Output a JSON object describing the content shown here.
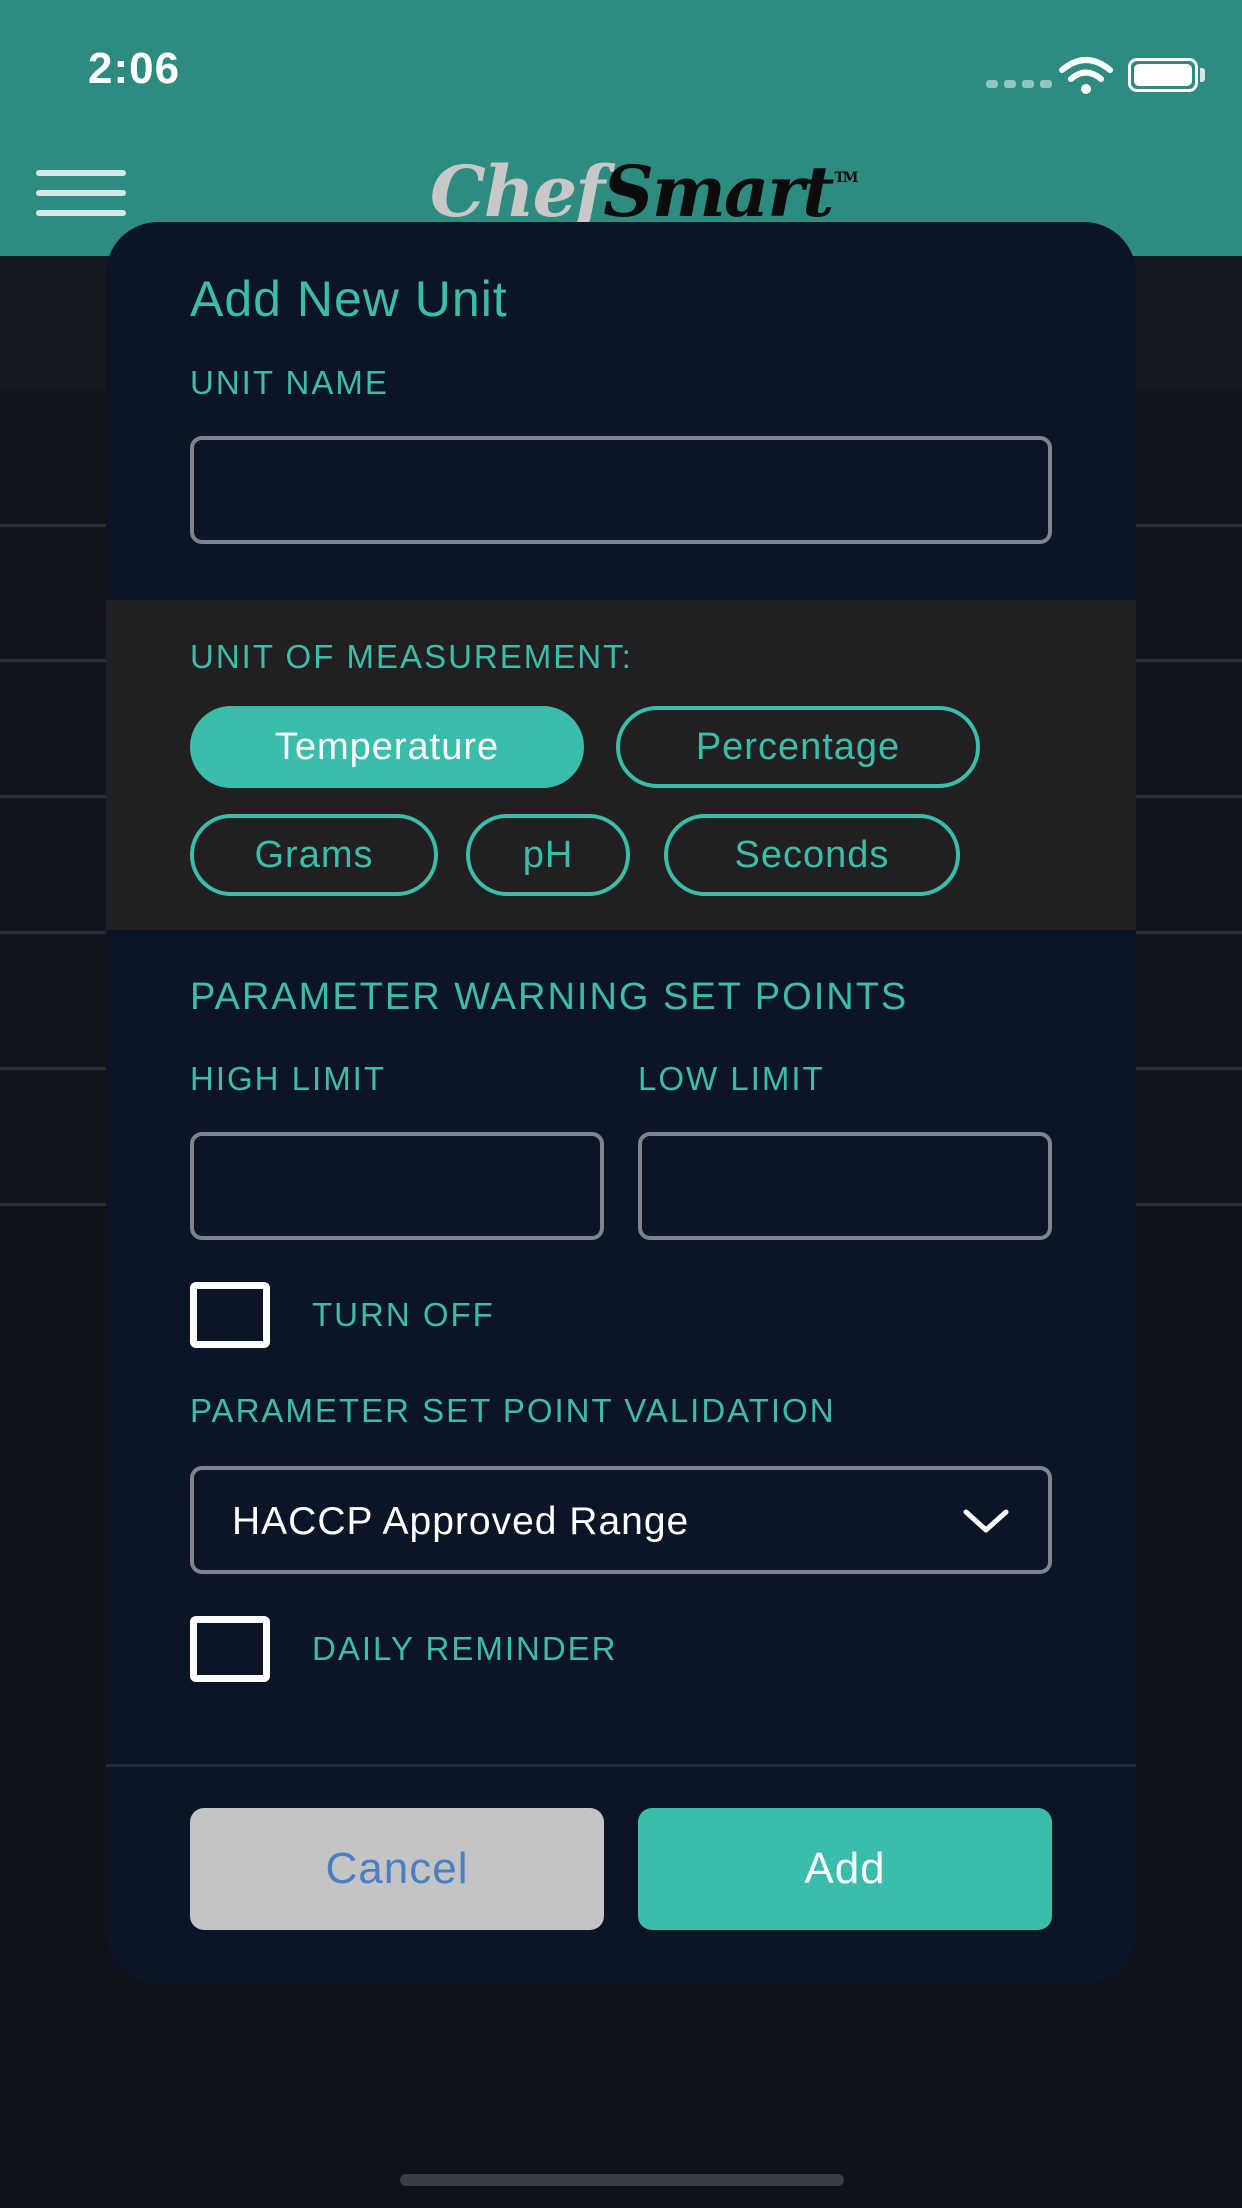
{
  "status_bar": {
    "time": "2:06"
  },
  "header": {
    "logo_part1": "Chef",
    "logo_part2": "Smart",
    "logo_tm": "TM"
  },
  "modal": {
    "title": "Add New Unit",
    "unit_name": {
      "label": "UNIT NAME",
      "value": ""
    },
    "measurement": {
      "label": "UNIT OF MEASUREMENT:",
      "options": [
        "Temperature",
        "Percentage",
        "Grams",
        "pH",
        "Seconds"
      ],
      "selected": "Temperature"
    },
    "warning_set_points": {
      "heading": "PARAMETER WARNING SET POINTS",
      "high_limit_label": "HIGH LIMIT",
      "low_limit_label": "LOW LIMIT",
      "high_limit_value": "",
      "low_limit_value": "",
      "turn_off_label": "TURN OFF",
      "turn_off_checked": false
    },
    "validation": {
      "label": "PARAMETER SET POINT VALIDATION",
      "selected": "HACCP Approved Range"
    },
    "daily_reminder": {
      "label": "DAILY REMINDER",
      "checked": false
    },
    "buttons": {
      "cancel": "Cancel",
      "add": "Add"
    }
  },
  "colors": {
    "header_bg": "#2d8b80",
    "accent": "#3bbdab",
    "modal_bg": "#0c1526",
    "cancel_bg": "#c4c4c4",
    "cancel_text": "#4a80c2"
  }
}
